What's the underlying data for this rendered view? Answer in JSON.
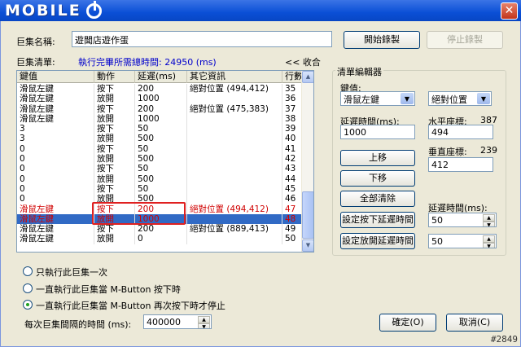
{
  "window": {
    "logo_text": "MOBILE",
    "close_glyph": "✕"
  },
  "macro_name": {
    "label": "巨集名稱:",
    "value": "遊聞店遊作蛋"
  },
  "buttons": {
    "start_record": "開始錄製",
    "stop_record": "停止錄製",
    "move_up": "上移",
    "move_down": "下移",
    "clear_all": "全部清除",
    "set_press_delay": "設定按下延遲時間",
    "set_release_delay": "設定放開延遲時間",
    "ok": "確定(O)",
    "cancel": "取消(C)"
  },
  "macro_list": {
    "label": "巨集清單:",
    "total_time": "執行完畢所需總時間: 24950 (ms)",
    "collapse": "<< 收合",
    "columns": [
      "鍵值",
      "動作",
      "延遲(ms)",
      "其它資訊",
      "行數"
    ],
    "rows": [
      {
        "key": "滑鼠左鍵",
        "action": "按下",
        "delay": "200",
        "info": "絕對位置 (494,412)",
        "line": "35",
        "state": ""
      },
      {
        "key": "滑鼠左鍵",
        "action": "放開",
        "delay": "1000",
        "info": "",
        "line": "36",
        "state": ""
      },
      {
        "key": "滑鼠左鍵",
        "action": "按下",
        "delay": "200",
        "info": "絕對位置 (475,383)",
        "line": "37",
        "state": ""
      },
      {
        "key": "滑鼠左鍵",
        "action": "放開",
        "delay": "1000",
        "info": "",
        "line": "38",
        "state": ""
      },
      {
        "key": "3",
        "action": "按下",
        "delay": "50",
        "info": "",
        "line": "39",
        "state": ""
      },
      {
        "key": "3",
        "action": "放開",
        "delay": "500",
        "info": "",
        "line": "40",
        "state": ""
      },
      {
        "key": "0",
        "action": "按下",
        "delay": "50",
        "info": "",
        "line": "41",
        "state": ""
      },
      {
        "key": "0",
        "action": "放開",
        "delay": "500",
        "info": "",
        "line": "42",
        "state": ""
      },
      {
        "key": "0",
        "action": "按下",
        "delay": "50",
        "info": "",
        "line": "43",
        "state": ""
      },
      {
        "key": "0",
        "action": "放開",
        "delay": "500",
        "info": "",
        "line": "44",
        "state": ""
      },
      {
        "key": "0",
        "action": "按下",
        "delay": "50",
        "info": "",
        "line": "45",
        "state": ""
      },
      {
        "key": "0",
        "action": "放開",
        "delay": "500",
        "info": "",
        "line": "46",
        "state": ""
      },
      {
        "key": "滑鼠左鍵",
        "action": "按下",
        "delay": "200",
        "info": "絕對位置 (494,412)",
        "line": "47",
        "state": "red"
      },
      {
        "key": "滑鼠左鍵",
        "action": "放開",
        "delay": "1000",
        "info": "",
        "line": "48",
        "state": "sel"
      },
      {
        "key": "滑鼠左鍵",
        "action": "按下",
        "delay": "200",
        "info": "絕對位置 (889,413)",
        "line": "49",
        "state": ""
      },
      {
        "key": "滑鼠左鍵",
        "action": "放開",
        "delay": "0",
        "info": "",
        "line": "50",
        "state": ""
      }
    ]
  },
  "editor": {
    "title": "清單編輯器",
    "key_label": "鍵值:",
    "key_value": "滑鼠左鍵",
    "position_value": "絕對位置",
    "delay_label": "延遲時間(ms):",
    "delay_value": "1000",
    "x_label": "水平座標:",
    "x_readout": "387",
    "x_value": "494",
    "y_label": "垂直座標:",
    "y_readout": "239",
    "y_value": "412",
    "delay2_label": "延遲時間(ms):",
    "press_delay_value": "50",
    "release_delay_value": "50"
  },
  "options": {
    "run_once": "只執行此巨集一次",
    "run_while_held": "一直執行此巨集當 M-Button 按下時",
    "run_until_pressed": "一直執行此巨集當 M-Button 再次按下時才停止",
    "interval_label": "每次巨集間隔的時間 (ms):",
    "interval_value": "400000"
  },
  "watermark": "#2849",
  "colors": {
    "title_blue": "#0a4fd6",
    "highlight_red": "#e02020",
    "selected_row": "#316ac5",
    "info_blue": "#0000cc"
  }
}
